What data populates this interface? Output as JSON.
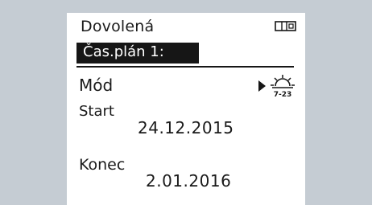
{
  "header": {
    "title": "Dovolená",
    "status_icon": "battery-icon"
  },
  "title_bar": {
    "label": "Čas.plán 1:"
  },
  "mode": {
    "label": "Mód",
    "icon": "sun-schedule-icon",
    "icon_caption": "7-23"
  },
  "start": {
    "label": "Start",
    "date": "24.12.2015"
  },
  "end": {
    "label": "Konec",
    "date": "2.01.2016"
  },
  "colors": {
    "background": "#c5ccd3",
    "screen": "#ffffff",
    "ink": "#161616"
  }
}
